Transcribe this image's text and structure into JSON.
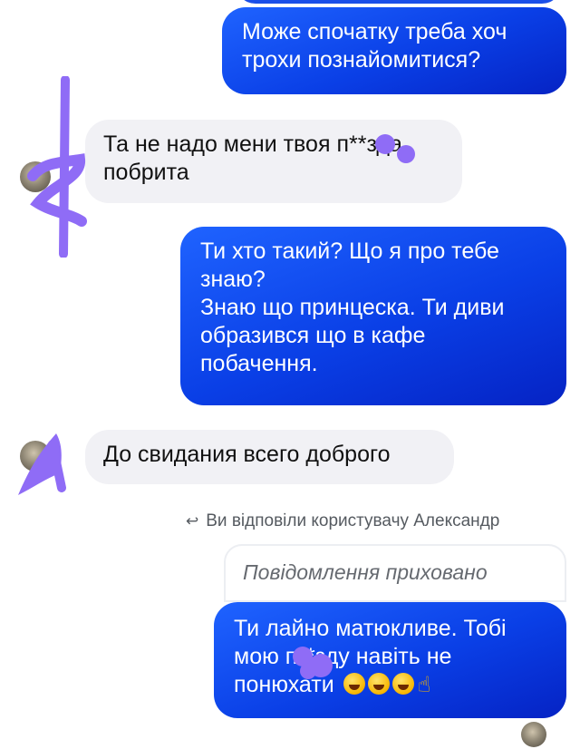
{
  "chat": {
    "messages": [
      {
        "direction": "outgoing",
        "text": "Може спочатку треба хоч\nтрохи познайомитися?"
      },
      {
        "direction": "incoming",
        "text": "Та не надо  мени твоя п**зда\nпобрита"
      },
      {
        "direction": "outgoing",
        "text": "Ти хто такий? Що я про тебе\nзнаю?\nЗнаю що принцеска. Ти диви\nобразився що в кафе\nпобачення."
      },
      {
        "direction": "incoming",
        "text": "До свидания всего доброго"
      }
    ],
    "reply_note": "Ви відповіли користувачу Александр",
    "reply_quote": "Повідомлення приховано",
    "last_message": {
      "line1": "Ти лайно матюкливе. Тобі",
      "line2": "мою п**зду навіть не",
      "line3": "понюхати",
      "emoji_names": [
        "rolling-on-floor-laughing-emoji",
        "rolling-on-floor-laughing-emoji",
        "rolling-on-floor-laughing-emoji",
        "middle-finger-emoji"
      ]
    }
  },
  "colors": {
    "outgoing_bubble": "#0a3fe6",
    "incoming_bubble": "#f1f1f5",
    "scribble": "#8f6cf6"
  },
  "icons": [
    "reply-arrow-icon",
    "contact-avatar-icon"
  ]
}
